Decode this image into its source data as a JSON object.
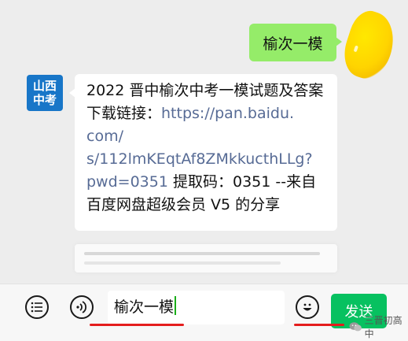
{
  "outgoing": {
    "text": "榆次一模"
  },
  "incoming": {
    "account_avatar": {
      "line1": "山西",
      "line2": "中考"
    },
    "text_before_link": "2022 晋中榆次中考一模试题及答案下载链接：",
    "link_part1": "https://pan.baidu.",
    "link_part2": "com/",
    "link_part3": "s/112lmKEqtAf8ZMkkucthLLg?",
    "link_part4": "pwd=0351",
    "text_after_link": " 提取码：0351 --来自",
    "text_last": "百度网盘超级会员 V5 的分享"
  },
  "input": {
    "value": "榆次一模"
  },
  "send_button": {
    "label": "发送"
  },
  "watermark": {
    "text": "三晋初高中"
  },
  "colors": {
    "chat_bg": "#ededed",
    "outgoing_bubble": "#95ec69",
    "link": "#576b95",
    "send_button": "#07c160",
    "annotation": "#e41d1d"
  },
  "icons": [
    "menu-icon",
    "voice-icon",
    "emoji-icon",
    "wechat-icon"
  ]
}
